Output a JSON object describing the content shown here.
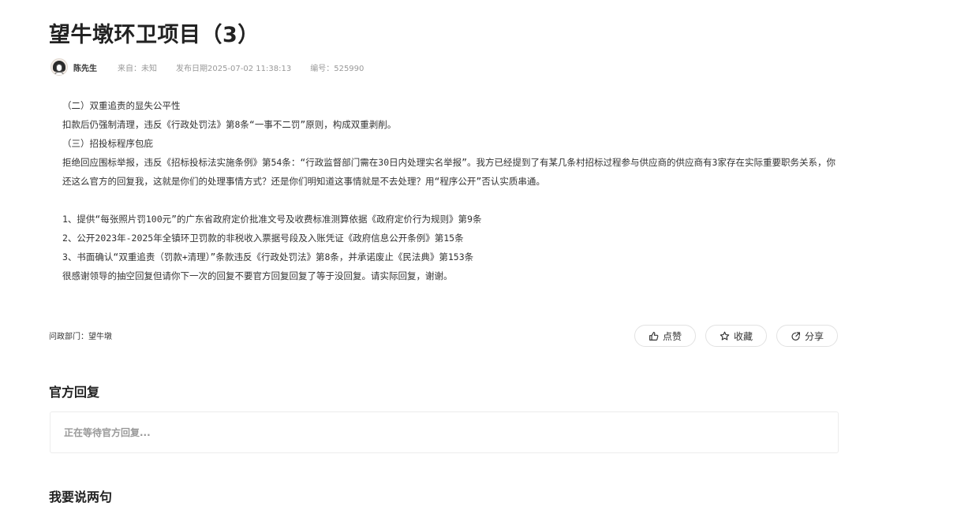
{
  "title": "望牛墩环卫项目（3）",
  "meta": {
    "author": "陈先生",
    "source": "来自：未知",
    "published": "发布日期2025-07-02 11:38:13",
    "number": "编号：525990"
  },
  "content": {
    "lines": [
      "（二）双重追责的显失公平性",
      "扣款后仍强制清理，违反《行政处罚法》第8条“一事不二罚”原则，构成双重剥削。",
      "（三）招投标程序包庇"
    ],
    "paragraph": "拒绝回应围标举报，违反《招标投标法实施条例》第54条：“行政监督部门需在30日内处理实名举报”。我方已经提到了有某几条村招标过程参与供应商的供应商有3家存在实际重要职务关系，你还这么官方的回复我，这就是你们的处理事情方式？还是你们明知道这事情就是不去处理？用“程序公开”否认实质串通。",
    "items": [
      "1、提供“每张照片罚100元”的广东省政府定价批准文号及收费标准测算依据《政府定价行为规则》第9条",
      "2、公开2023年-2025年全镇环卫罚款的非税收入票据号段及入账凭证《政府信息公开条例》第15条",
      "3、书面确认“双重追责（罚款+清理）”条款违反《行政处罚法》第8条，并承诺废止《民法典》第153条",
      "很感谢领导的抽空回复但请你下一次的回复不要官方回复回复了等于没回复。请实际回复，谢谢。"
    ]
  },
  "department": "问政部门：望牛墩",
  "actions": {
    "like_label": "点赞",
    "favorite_label": "收藏",
    "share_label": "分享"
  },
  "official_reply": {
    "title": "官方回复",
    "waiting_text": "正在等待官方回复..."
  },
  "comment": {
    "title": "我要说两句"
  }
}
